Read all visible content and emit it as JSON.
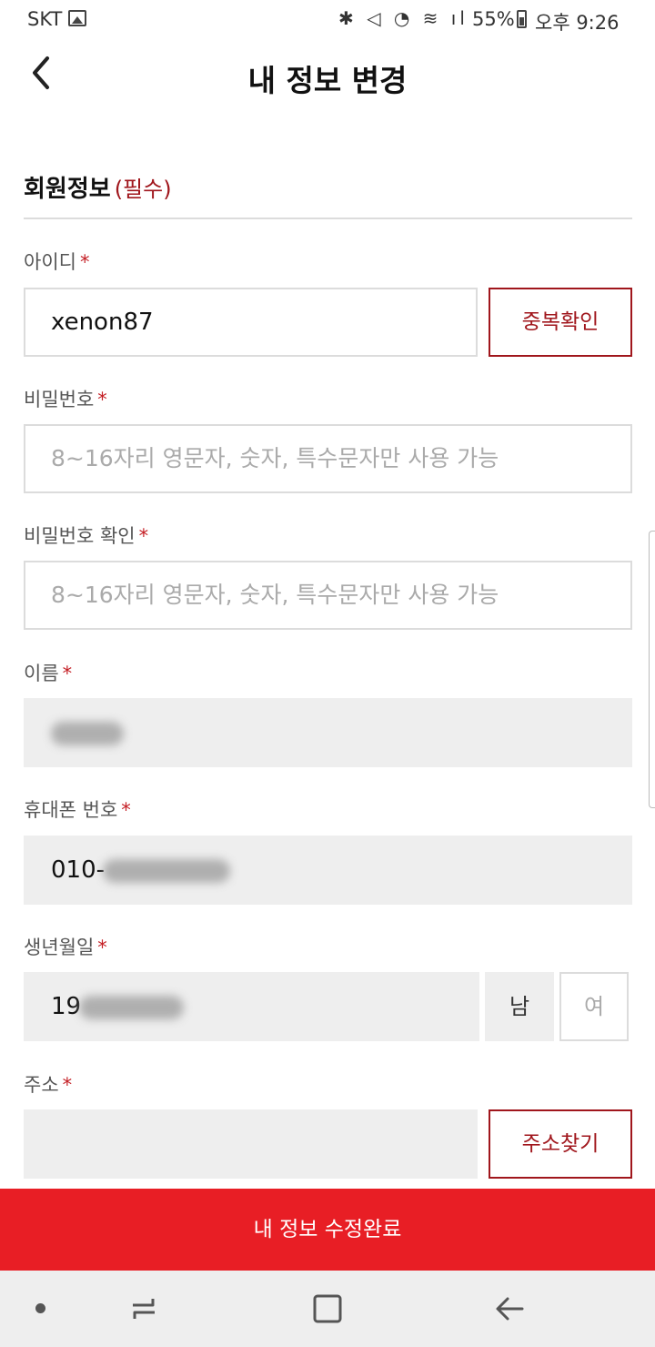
{
  "status_bar": {
    "carrier": "SKT",
    "status_icons": "✱ ◁ ◔ ≋ ıl",
    "battery": "55%",
    "time": "오후 9:26"
  },
  "header": {
    "title": "내 정보 변경"
  },
  "section": {
    "title": "회원정보",
    "required_note": "(필수)"
  },
  "form": {
    "asterisk": "*",
    "id": {
      "label": "아이디",
      "value": "xenon87",
      "check_button": "중복확인"
    },
    "password": {
      "label": "비밀번호",
      "placeholder": "8~16자리 영문자, 숫자, 특수문자만 사용 가능"
    },
    "password_confirm": {
      "label": "비밀번호 확인",
      "placeholder": "8~16자리 영문자, 숫자, 특수문자만 사용 가능"
    },
    "name": {
      "label": "이름"
    },
    "phone": {
      "label": "휴대폰 번호",
      "value_prefix": "010-"
    },
    "birth": {
      "label": "생년월일",
      "value_prefix": "19",
      "male": "남",
      "female": "여"
    },
    "address": {
      "label": "주소",
      "search_button": "주소찾기"
    }
  },
  "submit_label": "내 정보 수정완료",
  "colors": {
    "accent": "#e81e25",
    "accent_dark": "#a0161c",
    "readonly_bg": "#eeeeee"
  }
}
